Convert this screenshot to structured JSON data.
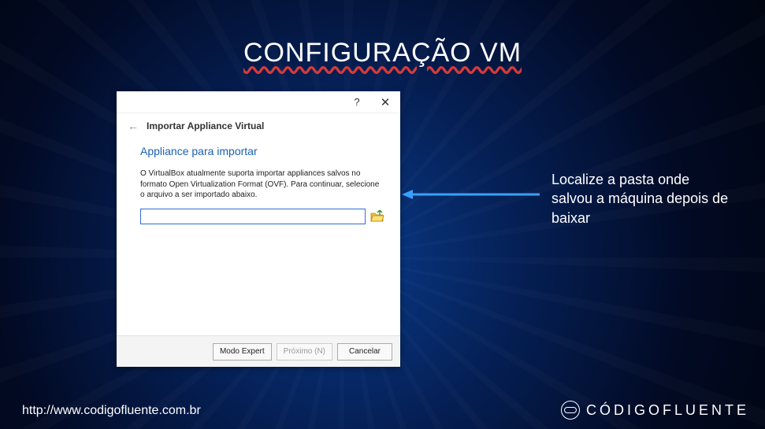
{
  "slide": {
    "title": "CONFIGURAÇÃO VM",
    "callout": "Localize a pasta onde salvou a máquina depois de baixar",
    "footer_url": "http://www.codigofluente.com.br",
    "brand": "CÓDIGOFLUENTE"
  },
  "dialog": {
    "titlebar": {
      "help": "?",
      "close": "✕"
    },
    "back_label": "←",
    "header_title": "Importar Appliance Virtual",
    "section_title": "Appliance para importar",
    "body_text": "O VirtualBox atualmente suporta importar appliances salvos no formato Open Virtualization Format (OVF). Para continuar, selecione o arquivo a ser importado abaixo.",
    "path_value": "",
    "footer": {
      "expert": "Modo Expert",
      "next": "Próximo (N)",
      "cancel": "Cancelar"
    }
  }
}
